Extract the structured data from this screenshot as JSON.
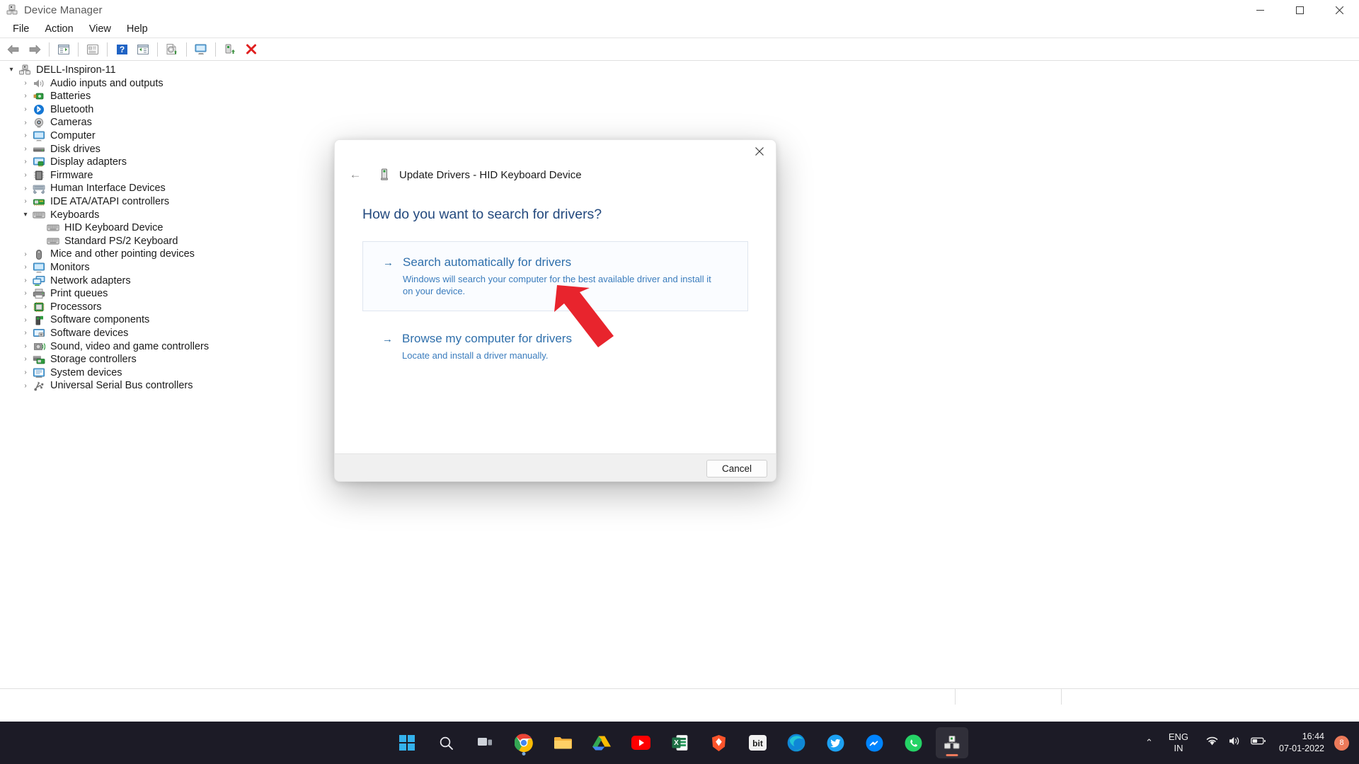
{
  "window": {
    "title": "Device Manager",
    "app_icon": "device-manager-icon",
    "controls": {
      "minimize": "–",
      "maximize": "□",
      "close": "✕"
    }
  },
  "menubar": {
    "items": [
      "File",
      "Action",
      "View",
      "Help"
    ]
  },
  "toolbar": {
    "buttons": [
      {
        "name": "back-button",
        "icon": "left-arrow-icon"
      },
      {
        "name": "forward-button",
        "icon": "right-arrow-icon"
      },
      {
        "name": "show-hide-console-tree-button",
        "icon": "console-tree-icon"
      },
      {
        "name": "properties-button",
        "icon": "properties-icon"
      },
      {
        "name": "help-button",
        "icon": "help-icon"
      },
      {
        "name": "show-hide-action-pane-button",
        "icon": "action-pane-icon"
      },
      {
        "name": "update-driver-button",
        "icon": "update-driver-icon"
      },
      {
        "name": "scan-for-hardware-changes-button",
        "icon": "scan-hardware-icon"
      },
      {
        "name": "enable-device-button",
        "icon": "enable-device-icon"
      },
      {
        "name": "uninstall-device-button",
        "icon": "red-x-icon"
      }
    ]
  },
  "tree": {
    "root": {
      "label": "DELL-Inspiron-11",
      "icon": "computer-root-icon",
      "expanded": true
    },
    "nodes": [
      {
        "label": "Audio inputs and outputs",
        "icon": "speaker-icon",
        "level": 1,
        "expandable": true,
        "expanded": false
      },
      {
        "label": "Batteries",
        "icon": "battery-icon",
        "level": 1,
        "expandable": true,
        "expanded": false
      },
      {
        "label": "Bluetooth",
        "icon": "bluetooth-icon",
        "level": 1,
        "expandable": true,
        "expanded": false
      },
      {
        "label": "Cameras",
        "icon": "camera-icon",
        "level": 1,
        "expandable": true,
        "expanded": false
      },
      {
        "label": "Computer",
        "icon": "monitor-icon",
        "level": 1,
        "expandable": true,
        "expanded": false
      },
      {
        "label": "Disk drives",
        "icon": "disk-drive-icon",
        "level": 1,
        "expandable": true,
        "expanded": false
      },
      {
        "label": "Display adapters",
        "icon": "display-adapter-icon",
        "level": 1,
        "expandable": true,
        "expanded": false
      },
      {
        "label": "Firmware",
        "icon": "firmware-chip-icon",
        "level": 1,
        "expandable": true,
        "expanded": false
      },
      {
        "label": "Human Interface Devices",
        "icon": "hid-icon",
        "level": 1,
        "expandable": true,
        "expanded": false
      },
      {
        "label": "IDE ATA/ATAPI controllers",
        "icon": "ide-controller-icon",
        "level": 1,
        "expandable": true,
        "expanded": false
      },
      {
        "label": "Keyboards",
        "icon": "keyboard-icon",
        "level": 1,
        "expandable": true,
        "expanded": true
      },
      {
        "label": "HID Keyboard Device",
        "icon": "keyboard-icon",
        "level": 2,
        "expandable": false,
        "expanded": false
      },
      {
        "label": "Standard PS/2 Keyboard",
        "icon": "keyboard-icon",
        "level": 2,
        "expandable": false,
        "expanded": false
      },
      {
        "label": "Mice and other pointing devices",
        "icon": "mouse-icon",
        "level": 1,
        "expandable": true,
        "expanded": false
      },
      {
        "label": "Monitors",
        "icon": "monitor-icon",
        "level": 1,
        "expandable": true,
        "expanded": false
      },
      {
        "label": "Network adapters",
        "icon": "network-adapter-icon",
        "level": 1,
        "expandable": true,
        "expanded": false
      },
      {
        "label": "Print queues",
        "icon": "printer-icon",
        "level": 1,
        "expandable": true,
        "expanded": false
      },
      {
        "label": "Processors",
        "icon": "processor-icon",
        "level": 1,
        "expandable": true,
        "expanded": false
      },
      {
        "label": "Software components",
        "icon": "software-component-icon",
        "level": 1,
        "expandable": true,
        "expanded": false
      },
      {
        "label": "Software devices",
        "icon": "software-device-icon",
        "level": 1,
        "expandable": true,
        "expanded": false
      },
      {
        "label": "Sound, video and game controllers",
        "icon": "sound-controller-icon",
        "level": 1,
        "expandable": true,
        "expanded": false
      },
      {
        "label": "Storage controllers",
        "icon": "storage-controller-icon",
        "level": 1,
        "expandable": true,
        "expanded": false
      },
      {
        "label": "System devices",
        "icon": "system-device-icon",
        "level": 1,
        "expandable": true,
        "expanded": false
      },
      {
        "label": "Universal Serial Bus controllers",
        "icon": "usb-controller-icon",
        "level": 1,
        "expandable": true,
        "expanded": false
      }
    ]
  },
  "dialog": {
    "back_icon": "back-arrow-icon",
    "close_icon": "close-icon",
    "header_icon": "keyboard-device-icon",
    "header_title": "Update Drivers - HID Keyboard Device",
    "question": "How do you want to search for drivers?",
    "options": [
      {
        "name": "search-automatically-option",
        "arrow": "→",
        "title": "Search automatically for drivers",
        "description": "Windows will search your computer for the best available driver and install it on your device.",
        "highlighted": true
      },
      {
        "name": "browse-my-computer-option",
        "arrow": "→",
        "title": "Browse my computer for drivers",
        "description": "Locate and install a driver manually.",
        "highlighted": false
      }
    ],
    "cancel_label": "Cancel"
  },
  "annotation": {
    "type": "red-arrow",
    "color": "#e8242d"
  },
  "taskbar": {
    "apps": [
      {
        "name": "start-button",
        "icon": "windows-logo-icon"
      },
      {
        "name": "search-button",
        "icon": "search-icon"
      },
      {
        "name": "task-view-button",
        "icon": "task-view-icon"
      },
      {
        "name": "chrome-button",
        "icon": "chrome-icon",
        "running": true
      },
      {
        "name": "file-explorer-button",
        "icon": "folder-icon"
      },
      {
        "name": "google-drive-button",
        "icon": "drive-icon"
      },
      {
        "name": "youtube-button",
        "icon": "youtube-icon"
      },
      {
        "name": "excel-button",
        "icon": "excel-icon"
      },
      {
        "name": "brave-button",
        "icon": "brave-icon"
      },
      {
        "name": "bit-button",
        "icon": "bit-icon"
      },
      {
        "name": "edge-button",
        "icon": "edge-icon"
      },
      {
        "name": "twitter-button",
        "icon": "twitter-icon"
      },
      {
        "name": "messenger-button",
        "icon": "messenger-icon"
      },
      {
        "name": "whatsapp-button",
        "icon": "whatsapp-icon"
      },
      {
        "name": "device-manager-button",
        "icon": "device-manager-icon",
        "active": true
      }
    ],
    "tray": {
      "chevron": "⌃",
      "language_line1": "ENG",
      "language_line2": "IN",
      "icons": [
        "wifi-icon",
        "volume-icon",
        "battery-icon"
      ],
      "time": "16:44",
      "date": "07-01-2022",
      "notification_count": "8"
    }
  }
}
